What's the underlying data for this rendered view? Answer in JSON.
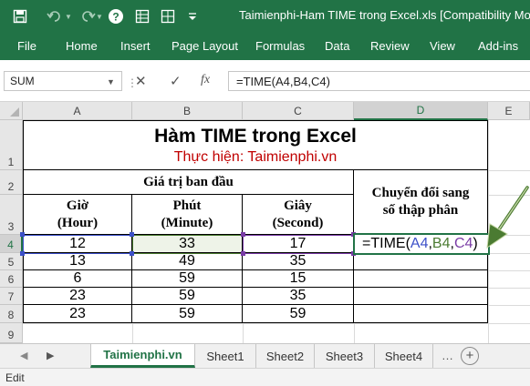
{
  "window": {
    "title": "Taimienphi-Ham TIME trong Excel.xls  [Compatibility Mode]",
    "accent_color": "#217346",
    "quick_access_icons": [
      "save-icon",
      "undo-icon",
      "redo-icon",
      "help-icon",
      "form-icon",
      "customize-icon"
    ]
  },
  "ribbon": {
    "tabs": [
      "File",
      "Home",
      "Insert",
      "Page Layout",
      "Formulas",
      "Data",
      "Review",
      "View",
      "Add-ins"
    ]
  },
  "formula_bar": {
    "name_box": "SUM",
    "cancel_symbol": "✕",
    "enter_symbol": "✓",
    "fx_symbol": "fx",
    "formula": "=TIME(A4,B4,C4)"
  },
  "grid": {
    "columns": [
      "A",
      "B",
      "C",
      "D",
      "E"
    ],
    "rows": [
      "1",
      "2",
      "3",
      "4",
      "5",
      "6",
      "7",
      "8",
      "9"
    ],
    "active_column": "D",
    "active_row": "4",
    "title": "Hàm TIME trong Excel",
    "subtitle": "Thực hiện: Taimienphi.vn",
    "group_header": "Giá trị ban đầu",
    "headers": {
      "hour": "Giờ\n(Hour)",
      "minute": "Phút\n(Minute)",
      "second": "Giây\n(Second)",
      "decimal": "Chuyển đổi sang\nsố thập phân"
    },
    "data_rows": [
      [
        "12",
        "33",
        "17"
      ],
      [
        "13",
        "49",
        "35"
      ],
      [
        "6",
        "59",
        "15"
      ],
      [
        "23",
        "59",
        "35"
      ],
      [
        "23",
        "59",
        "59"
      ]
    ],
    "editing_cell": {
      "prefix": "=TIME(",
      "ref_a": "A4",
      "sep1": ",",
      "ref_b": "B4",
      "sep2": ",",
      "ref_c": "C4",
      "suffix": ")"
    },
    "ref_colors": {
      "a": "#3c50c8",
      "b": "#4b7b32",
      "c": "#7a3ca6"
    }
  },
  "sheet_tabs": {
    "active": "Taimienphi.vn",
    "tabs": [
      "Taimienphi.vn",
      "Sheet1",
      "Sheet2",
      "Sheet3",
      "Sheet4"
    ]
  },
  "status_bar": {
    "mode": "Edit"
  }
}
